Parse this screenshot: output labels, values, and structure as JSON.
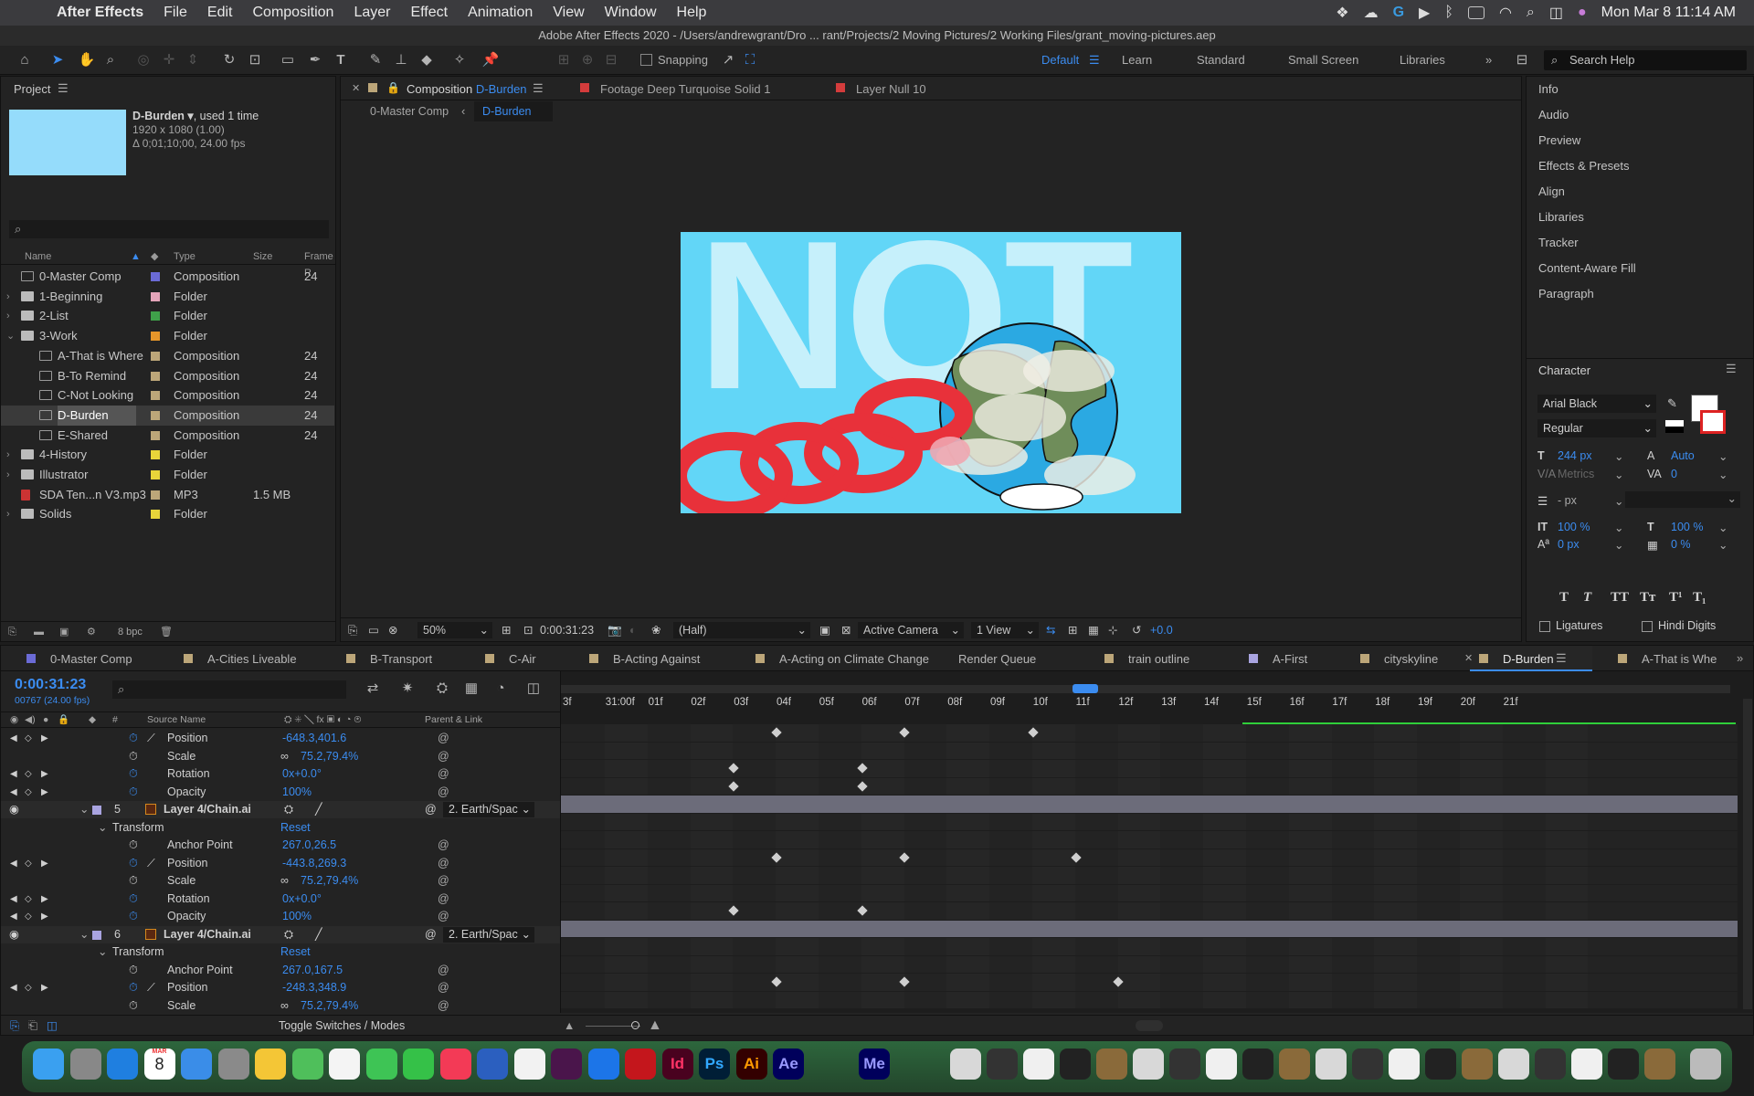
{
  "menubar": {
    "app_name": "After Effects",
    "items": [
      "File",
      "Edit",
      "Composition",
      "Layer",
      "Effect",
      "Animation",
      "View",
      "Window",
      "Help"
    ],
    "clock": "Mon Mar 8  11:14 AM"
  },
  "window_title": "Adobe After Effects 2020 - /Users/andrewgrant/Dro ... rant/Projects/2 Moving Pictures/2 Working Files/grant_moving-pictures.aep",
  "toolbar": {
    "snapping_label": "Snapping",
    "workspaces": [
      "Default",
      "Learn",
      "Standard",
      "Small Screen",
      "Libraries"
    ],
    "search_placeholder": "Search Help"
  },
  "project": {
    "tab_label": "Project",
    "selected_name": "D-Burden ▾",
    "used": ", used 1 time",
    "dims": "1920 x 1080 (1.00)",
    "duration": "Δ 0;01;10;00, 24.00 fps",
    "columns": [
      "Name",
      "Type",
      "Size",
      "Frame R"
    ],
    "rows": [
      {
        "name": "0-Master Comp",
        "type": "Composition",
        "size": "",
        "frame": "24",
        "color": "#6b6bd6",
        "indent": 0,
        "kind": "comp",
        "arrow": ""
      },
      {
        "name": "1-Beginning",
        "type": "Folder",
        "size": "",
        "frame": "",
        "color": "#e4a4b9",
        "indent": 0,
        "kind": "folder",
        "arrow": "›"
      },
      {
        "name": "2-List",
        "type": "Folder",
        "size": "",
        "frame": "",
        "color": "#3fa14a",
        "indent": 0,
        "kind": "folder",
        "arrow": "›"
      },
      {
        "name": "3-Work",
        "type": "Folder",
        "size": "",
        "frame": "",
        "color": "#e6962a",
        "indent": 0,
        "kind": "folder",
        "arrow": "⌄"
      },
      {
        "name": "A-That is Where",
        "type": "Composition",
        "size": "",
        "frame": "24",
        "color": "#bca679",
        "indent": 1,
        "kind": "comp",
        "arrow": ""
      },
      {
        "name": "B-To Remind",
        "type": "Composition",
        "size": "",
        "frame": "24",
        "color": "#bca679",
        "indent": 1,
        "kind": "comp",
        "arrow": ""
      },
      {
        "name": "C-Not Looking",
        "type": "Composition",
        "size": "",
        "frame": "24",
        "color": "#bca679",
        "indent": 1,
        "kind": "comp",
        "arrow": ""
      },
      {
        "name": "D-Burden",
        "type": "Composition",
        "size": "",
        "frame": "24",
        "color": "#bca679",
        "indent": 1,
        "kind": "comp",
        "arrow": "",
        "selected": true
      },
      {
        "name": "E-Shared",
        "type": "Composition",
        "size": "",
        "frame": "24",
        "color": "#bca679",
        "indent": 1,
        "kind": "comp",
        "arrow": ""
      },
      {
        "name": "4-History",
        "type": "Folder",
        "size": "",
        "frame": "",
        "color": "#e8d53a",
        "indent": 0,
        "kind": "folder",
        "arrow": "›"
      },
      {
        "name": "Illustrator",
        "type": "Folder",
        "size": "",
        "frame": "",
        "color": "#e8d53a",
        "indent": 0,
        "kind": "folder",
        "arrow": "›"
      },
      {
        "name": "SDA Ten...n V3.mp3",
        "type": "MP3",
        "size": "1.5 MB",
        "frame": "",
        "color": "#bca679",
        "indent": 0,
        "kind": "audio",
        "arrow": ""
      },
      {
        "name": "Solids",
        "type": "Folder",
        "size": "",
        "frame": "",
        "color": "#e8d53a",
        "indent": 0,
        "kind": "folder",
        "arrow": "›"
      }
    ],
    "bpc": "8 bpc"
  },
  "composition": {
    "tabs": [
      {
        "label": "Composition",
        "name": "D-Burden",
        "color": "#bca679"
      },
      {
        "label": "Footage Deep Turquoise Solid 1",
        "color": "#d43c3c"
      },
      {
        "label": "Layer Null 10",
        "color": "#d43c3c"
      }
    ],
    "breadcrumbs": [
      "0-Master Comp",
      "D-Burden"
    ],
    "artwork_text": "NOT",
    "footer": {
      "zoom": "50%",
      "timecode": "0:00:31:23",
      "resolution": "(Half)",
      "camera": "Active Camera",
      "views": "1 View",
      "exposure": "+0.0"
    }
  },
  "right_panel": {
    "items": [
      "Info",
      "Audio",
      "Preview",
      "Effects & Presets",
      "Align",
      "Libraries",
      "Tracker",
      "Content-Aware Fill",
      "Paragraph"
    ],
    "character": {
      "title": "Character",
      "font": "Arial Black",
      "style": "Regular",
      "size": "244 px",
      "leading": "Auto",
      "kerning": "Metrics",
      "tracking": "0",
      "stroke": "- px",
      "vscale": "100 %",
      "hscale": "100 %",
      "baseline": "0 px",
      "tsume": "0 %",
      "format_buttons": [
        "T",
        "T",
        "TT",
        "Tт",
        "T¹",
        "T₁"
      ],
      "ligatures": "Ligatures",
      "hindi": "Hindi Digits"
    }
  },
  "timeline": {
    "tabs": [
      {
        "label": "0-Master Comp",
        "color": "#6b6bd6"
      },
      {
        "label": "A-Cities Liveable",
        "color": "#bca679"
      },
      {
        "label": "B-Transport",
        "color": "#bca679"
      },
      {
        "label": "C-Air",
        "color": "#bca679"
      },
      {
        "label": "B-Acting Against",
        "color": "#bca679"
      },
      {
        "label": "A-Acting on Climate Change",
        "color": "#bca679"
      },
      {
        "label": "Render Queue",
        "color": ""
      },
      {
        "label": "train outline",
        "color": "#bca679"
      },
      {
        "label": "A-First",
        "color": "#a9a4e0"
      },
      {
        "label": "cityskyline",
        "color": "#bca679"
      },
      {
        "label": "D-Burden",
        "color": "#bca679",
        "active": true
      },
      {
        "label": "A-That is Whe",
        "color": "#bca679"
      }
    ],
    "timecode": "0:00:31:23",
    "frames": "00767 (24.00 fps)",
    "headers": {
      "num": "#",
      "source": "Source Name",
      "parent": "Parent & Link"
    },
    "ruler": [
      "3f",
      "31:00f",
      "01f",
      "02f",
      "03f",
      "04f",
      "05f",
      "06f",
      "07f",
      "08f",
      "09f",
      "10f",
      "11f",
      "12f",
      "13f",
      "14f",
      "15f",
      "16f",
      "17f",
      "18f",
      "19f",
      "20f",
      "21f"
    ],
    "rows": [
      {
        "type": "prop",
        "name": "Position",
        "value": "-648.3,401.6",
        "graph": true,
        "nav": true
      },
      {
        "type": "prop",
        "name": "Scale",
        "value": "75.2,79.4%",
        "link": true
      },
      {
        "type": "prop",
        "name": "Rotation",
        "value": "0x+0.0°",
        "nav": true
      },
      {
        "type": "prop",
        "name": "Opacity",
        "value": "100%",
        "nav": true
      },
      {
        "type": "layer",
        "num": "5",
        "name": "Layer 4/Chain.ai",
        "parent": "2. Earth/Spac"
      },
      {
        "type": "group",
        "name": "Transform",
        "value": "Reset"
      },
      {
        "type": "prop",
        "name": "Anchor Point",
        "value": "267.0,26.5"
      },
      {
        "type": "prop",
        "name": "Position",
        "value": "-443.8,269.3",
        "graph": true,
        "nav": true
      },
      {
        "type": "prop",
        "name": "Scale",
        "value": "75.2,79.4%",
        "link": true
      },
      {
        "type": "prop",
        "name": "Rotation",
        "value": "0x+0.0°",
        "nav": true
      },
      {
        "type": "prop",
        "name": "Opacity",
        "value": "100%",
        "nav": true
      },
      {
        "type": "layer",
        "num": "6",
        "name": "Layer 4/Chain.ai",
        "parent": "2. Earth/Spac"
      },
      {
        "type": "group",
        "name": "Transform",
        "value": "Reset"
      },
      {
        "type": "prop",
        "name": "Anchor Point",
        "value": "267.0,167.5"
      },
      {
        "type": "prop",
        "name": "Position",
        "value": "-248.3,348.9",
        "graph": true,
        "nav": true
      },
      {
        "type": "prop",
        "name": "Scale",
        "value": "75.2,79.4%",
        "link": true
      }
    ],
    "toggle_label": "Toggle Switches / Modes"
  },
  "dock": {
    "apps": [
      "finder-icon",
      "launchpad-icon",
      "safari-icon",
      "calendar-icon",
      "mail-icon",
      "system-preferences-icon",
      "notes-icon",
      "maps-icon",
      "photos-icon",
      "messages-icon",
      "facetime-icon",
      "music-icon",
      "word-icon",
      "chrome-icon",
      "slack-icon",
      "dropbox-icon",
      "acrobat-icon",
      "indesign-icon",
      "photoshop-icon",
      "illustrator-icon",
      "aftereffects-icon"
    ],
    "calendar_month": "MAR",
    "calendar_day": "8",
    "labels": {
      "id": "Id",
      "ps": "Ps",
      "ai": "Ai",
      "ae": "Ae",
      "me": "Me"
    }
  }
}
